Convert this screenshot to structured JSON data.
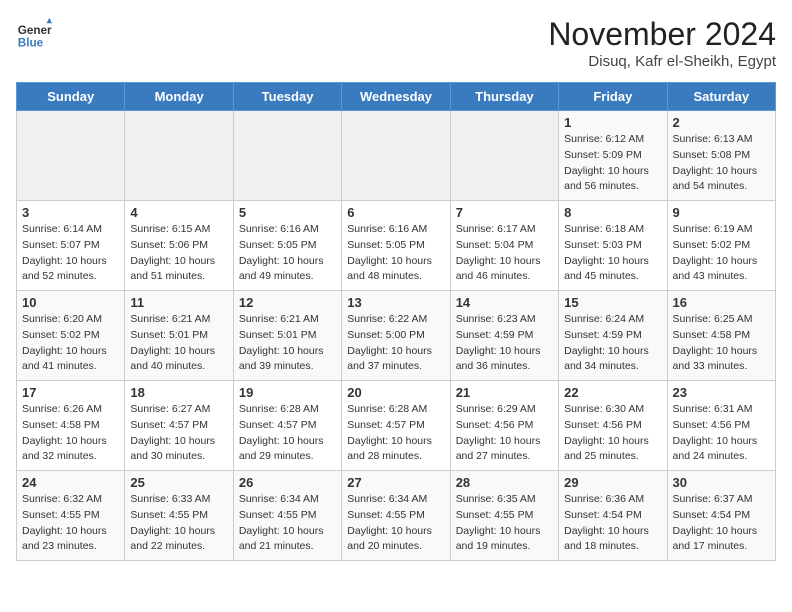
{
  "header": {
    "logo_general": "General",
    "logo_blue": "Blue",
    "title": "November 2024",
    "subtitle": "Disuq, Kafr el-Sheikh, Egypt"
  },
  "weekdays": [
    "Sunday",
    "Monday",
    "Tuesday",
    "Wednesday",
    "Thursday",
    "Friday",
    "Saturday"
  ],
  "weeks": [
    [
      {
        "day": "",
        "info": ""
      },
      {
        "day": "",
        "info": ""
      },
      {
        "day": "",
        "info": ""
      },
      {
        "day": "",
        "info": ""
      },
      {
        "day": "",
        "info": ""
      },
      {
        "day": "1",
        "info": "Sunrise: 6:12 AM\nSunset: 5:09 PM\nDaylight: 10 hours and 56 minutes."
      },
      {
        "day": "2",
        "info": "Sunrise: 6:13 AM\nSunset: 5:08 PM\nDaylight: 10 hours and 54 minutes."
      }
    ],
    [
      {
        "day": "3",
        "info": "Sunrise: 6:14 AM\nSunset: 5:07 PM\nDaylight: 10 hours and 52 minutes."
      },
      {
        "day": "4",
        "info": "Sunrise: 6:15 AM\nSunset: 5:06 PM\nDaylight: 10 hours and 51 minutes."
      },
      {
        "day": "5",
        "info": "Sunrise: 6:16 AM\nSunset: 5:05 PM\nDaylight: 10 hours and 49 minutes."
      },
      {
        "day": "6",
        "info": "Sunrise: 6:16 AM\nSunset: 5:05 PM\nDaylight: 10 hours and 48 minutes."
      },
      {
        "day": "7",
        "info": "Sunrise: 6:17 AM\nSunset: 5:04 PM\nDaylight: 10 hours and 46 minutes."
      },
      {
        "day": "8",
        "info": "Sunrise: 6:18 AM\nSunset: 5:03 PM\nDaylight: 10 hours and 45 minutes."
      },
      {
        "day": "9",
        "info": "Sunrise: 6:19 AM\nSunset: 5:02 PM\nDaylight: 10 hours and 43 minutes."
      }
    ],
    [
      {
        "day": "10",
        "info": "Sunrise: 6:20 AM\nSunset: 5:02 PM\nDaylight: 10 hours and 41 minutes."
      },
      {
        "day": "11",
        "info": "Sunrise: 6:21 AM\nSunset: 5:01 PM\nDaylight: 10 hours and 40 minutes."
      },
      {
        "day": "12",
        "info": "Sunrise: 6:21 AM\nSunset: 5:01 PM\nDaylight: 10 hours and 39 minutes."
      },
      {
        "day": "13",
        "info": "Sunrise: 6:22 AM\nSunset: 5:00 PM\nDaylight: 10 hours and 37 minutes."
      },
      {
        "day": "14",
        "info": "Sunrise: 6:23 AM\nSunset: 4:59 PM\nDaylight: 10 hours and 36 minutes."
      },
      {
        "day": "15",
        "info": "Sunrise: 6:24 AM\nSunset: 4:59 PM\nDaylight: 10 hours and 34 minutes."
      },
      {
        "day": "16",
        "info": "Sunrise: 6:25 AM\nSunset: 4:58 PM\nDaylight: 10 hours and 33 minutes."
      }
    ],
    [
      {
        "day": "17",
        "info": "Sunrise: 6:26 AM\nSunset: 4:58 PM\nDaylight: 10 hours and 32 minutes."
      },
      {
        "day": "18",
        "info": "Sunrise: 6:27 AM\nSunset: 4:57 PM\nDaylight: 10 hours and 30 minutes."
      },
      {
        "day": "19",
        "info": "Sunrise: 6:28 AM\nSunset: 4:57 PM\nDaylight: 10 hours and 29 minutes."
      },
      {
        "day": "20",
        "info": "Sunrise: 6:28 AM\nSunset: 4:57 PM\nDaylight: 10 hours and 28 minutes."
      },
      {
        "day": "21",
        "info": "Sunrise: 6:29 AM\nSunset: 4:56 PM\nDaylight: 10 hours and 27 minutes."
      },
      {
        "day": "22",
        "info": "Sunrise: 6:30 AM\nSunset: 4:56 PM\nDaylight: 10 hours and 25 minutes."
      },
      {
        "day": "23",
        "info": "Sunrise: 6:31 AM\nSunset: 4:56 PM\nDaylight: 10 hours and 24 minutes."
      }
    ],
    [
      {
        "day": "24",
        "info": "Sunrise: 6:32 AM\nSunset: 4:55 PM\nDaylight: 10 hours and 23 minutes."
      },
      {
        "day": "25",
        "info": "Sunrise: 6:33 AM\nSunset: 4:55 PM\nDaylight: 10 hours and 22 minutes."
      },
      {
        "day": "26",
        "info": "Sunrise: 6:34 AM\nSunset: 4:55 PM\nDaylight: 10 hours and 21 minutes."
      },
      {
        "day": "27",
        "info": "Sunrise: 6:34 AM\nSunset: 4:55 PM\nDaylight: 10 hours and 20 minutes."
      },
      {
        "day": "28",
        "info": "Sunrise: 6:35 AM\nSunset: 4:55 PM\nDaylight: 10 hours and 19 minutes."
      },
      {
        "day": "29",
        "info": "Sunrise: 6:36 AM\nSunset: 4:54 PM\nDaylight: 10 hours and 18 minutes."
      },
      {
        "day": "30",
        "info": "Sunrise: 6:37 AM\nSunset: 4:54 PM\nDaylight: 10 hours and 17 minutes."
      }
    ]
  ]
}
